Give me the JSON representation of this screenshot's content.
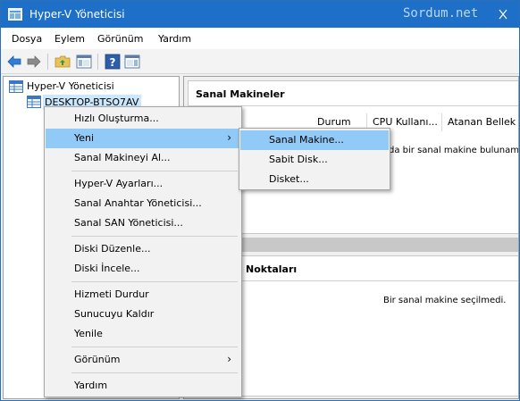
{
  "window": {
    "title": "Hyper-V Yöneticisi",
    "watermark": "Sordum.net",
    "colors": {
      "titlebar": "#1d6fc7",
      "highlight": "#91c9f7",
      "selection": "#cce8ff"
    }
  },
  "menubar": {
    "items": [
      "Dosya",
      "Eylem",
      "Görünüm",
      "Yardım"
    ]
  },
  "toolbar": {
    "icons": [
      "back-arrow-icon",
      "forward-arrow-icon",
      "up-folder-icon",
      "show-hide-tree-icon",
      "help-icon",
      "action-pane-icon"
    ]
  },
  "tree": {
    "root": "Hyper-V Yöneticisi",
    "host": "DESKTOP-BTSO7AV"
  },
  "vm_panel": {
    "title": "Sanal Makineler",
    "columns": [
      "Durum",
      "CPU Kullanı...",
      "Atanan Bellek"
    ],
    "empty_text": "da bir sanal makine bulunama"
  },
  "checkpoint_panel": {
    "title": "Noktaları",
    "empty_text": "Bir sanal makine seçilmedi."
  },
  "context_menu": {
    "items": [
      "Hızlı Oluşturma...",
      "Yeni",
      "Sanal Makineyi Al...",
      "Hyper-V Ayarları...",
      "Sanal Anahtar Yöneticisi...",
      "Sanal SAN Yöneticisi...",
      "Diski Düzenle...",
      "Diski İncele...",
      "Hizmeti Durdur",
      "Sunucuyu Kaldır",
      "Yenile",
      "Görünüm",
      "Yardım"
    ],
    "highlighted": "Yeni"
  },
  "submenu": {
    "items": [
      "Sanal Makine...",
      "Sabit Disk...",
      "Disket..."
    ],
    "highlighted": "Sanal Makine..."
  }
}
